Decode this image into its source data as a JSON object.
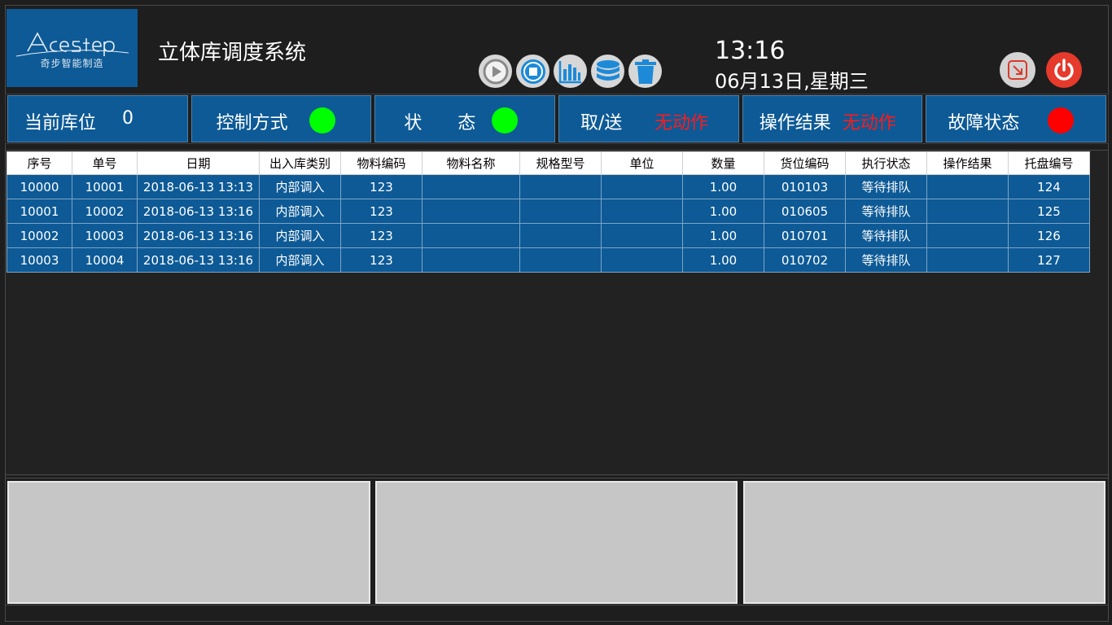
{
  "logo": {
    "brand": "AceStep",
    "tagline": "奇步智能制造"
  },
  "header": {
    "title": "立体库调度系统"
  },
  "toolbar": [
    {
      "name": "start-icon"
    },
    {
      "name": "stop-icon"
    },
    {
      "name": "chart-icon"
    },
    {
      "name": "database-icon"
    },
    {
      "name": "trash-icon"
    }
  ],
  "clock": {
    "time": "13:16",
    "date": "06月13日,星期三"
  },
  "status": {
    "location_label": "当前库位",
    "location_value": "0",
    "control_label": "控制方式",
    "control_color": "#00ff00",
    "state_label": "状　　态",
    "state_color": "#00ff00",
    "fetch_label": "取/送",
    "fetch_value": "无动作",
    "result_label": "操作结果",
    "result_value": "无动作",
    "fault_label": "故障状态",
    "fault_color": "#ff0000"
  },
  "table": {
    "headers": [
      "序号",
      "单号",
      "日期",
      "出入库类别",
      "物料编码",
      "物料名称",
      "规格型号",
      "单位",
      "数量",
      "货位编码",
      "执行状态",
      "操作结果",
      "托盘编号"
    ],
    "rows": [
      [
        "10000",
        "10001",
        "2018-06-13 13:13",
        "内部调入",
        "123",
        "",
        "",
        "",
        "1.00",
        "010103",
        "等待排队",
        "",
        "124"
      ],
      [
        "10001",
        "10002",
        "2018-06-13 13:16",
        "内部调入",
        "123",
        "",
        "",
        "",
        "1.00",
        "010605",
        "等待排队",
        "",
        "125"
      ],
      [
        "10002",
        "10003",
        "2018-06-13 13:16",
        "内部调入",
        "123",
        "",
        "",
        "",
        "1.00",
        "010701",
        "等待排队",
        "",
        "126"
      ],
      [
        "10003",
        "10004",
        "2018-06-13 13:16",
        "内部调入",
        "123",
        "",
        "",
        "",
        "1.00",
        "010702",
        "等待排队",
        "",
        "127"
      ]
    ]
  },
  "colors": {
    "panel_blue": "#0d5a96",
    "alert_red": "#ff1a1a",
    "ok_green": "#00ff00"
  }
}
